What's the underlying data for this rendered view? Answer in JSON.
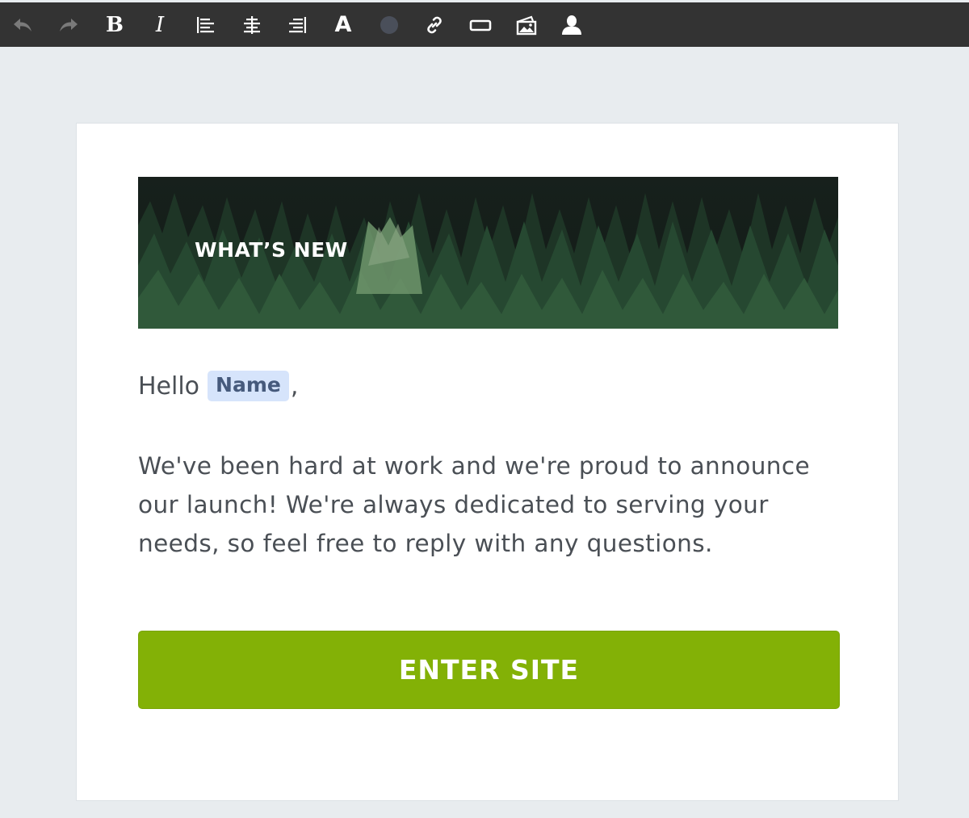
{
  "toolbar": {
    "buttons": [
      {
        "name": "undo-button",
        "icon": "undo-icon"
      },
      {
        "name": "redo-button",
        "icon": "redo-icon"
      },
      {
        "name": "bold-button",
        "icon": "bold-icon",
        "glyph": "B"
      },
      {
        "name": "italic-button",
        "icon": "italic-icon",
        "glyph": "I"
      },
      {
        "name": "align-left-button",
        "icon": "align-left-icon"
      },
      {
        "name": "align-center-button",
        "icon": "align-center-icon"
      },
      {
        "name": "align-right-button",
        "icon": "align-right-icon"
      },
      {
        "name": "font-button",
        "icon": "font-icon",
        "glyph": "A"
      },
      {
        "name": "text-color-button",
        "icon": "color-swatch-icon",
        "swatch": "#4a4f5a"
      },
      {
        "name": "link-button",
        "icon": "link-icon"
      },
      {
        "name": "insert-button-button",
        "icon": "button-block-icon"
      },
      {
        "name": "insert-image-button",
        "icon": "image-icon"
      },
      {
        "name": "merge-tag-button",
        "icon": "person-icon"
      }
    ],
    "disabled_color": "#7a7a7a",
    "background": "#333333"
  },
  "email": {
    "hero": {
      "title": "WHAT’S NEW"
    },
    "greeting": {
      "prefix": "Hello",
      "merge_tag": "Name",
      "suffix": ","
    },
    "body": "We've been hard at work and we're proud to announce our launch! We're always dedicated to serving your needs, so feel free to reply with any questions.",
    "cta": {
      "label": "ENTER SITE",
      "color": "#83b106"
    }
  },
  "colors": {
    "page_background": "#e8ecef",
    "card_background": "#ffffff",
    "text": "#4a4f55",
    "merge_tag_background": "#d6e4fb",
    "merge_tag_text": "#465a7c"
  }
}
